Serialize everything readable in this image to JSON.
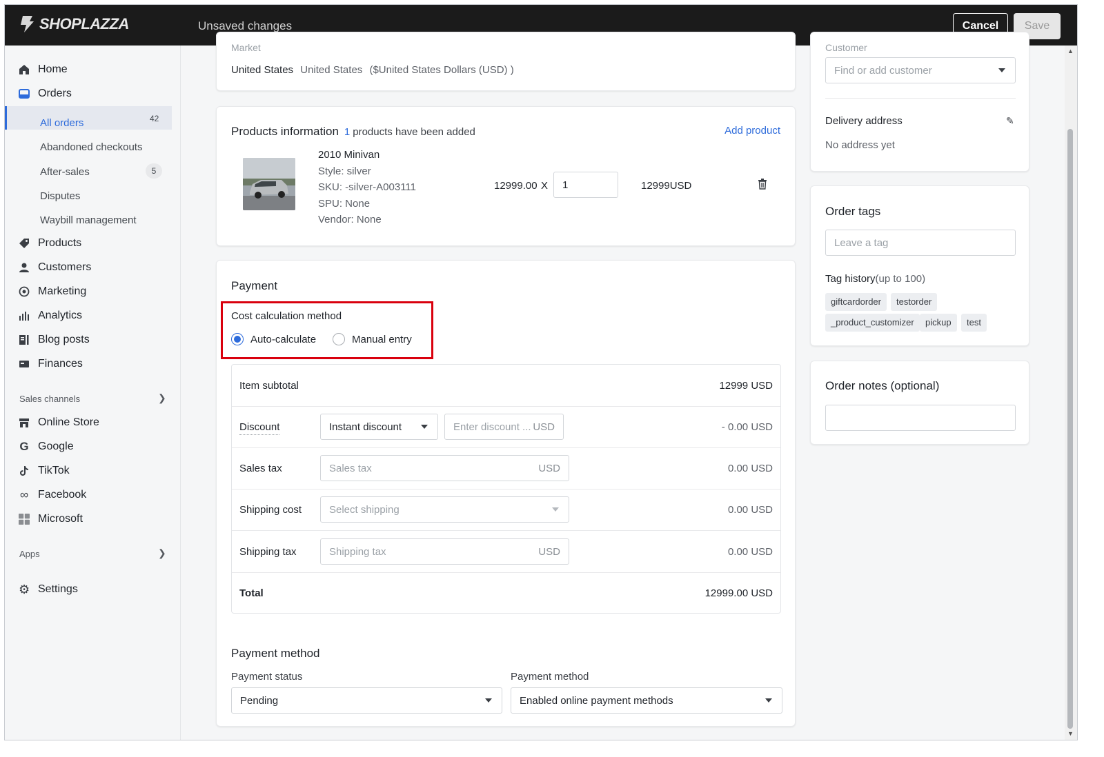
{
  "topbar": {
    "logo": "SHOPLAZZA",
    "status": "Unsaved changes",
    "cancel_label": "Cancel",
    "save_label": "Save"
  },
  "sidebar": {
    "home": "Home",
    "orders": "Orders",
    "all_orders": "All orders",
    "all_orders_count": "42",
    "abandoned": "Abandoned checkouts",
    "after_sales": "After-sales",
    "after_sales_count": "5",
    "disputes": "Disputes",
    "waybill": "Waybill management",
    "products": "Products",
    "customers": "Customers",
    "marketing": "Marketing",
    "analytics": "Analytics",
    "blog_posts": "Blog posts",
    "finances": "Finances",
    "sales_channels": "Sales channels",
    "online_store": "Online Store",
    "google": "Google",
    "tiktok": "TikTok",
    "facebook": "Facebook",
    "microsoft": "Microsoft",
    "apps": "Apps",
    "settings": "Settings"
  },
  "market": {
    "label": "Market",
    "country": "United States",
    "detail": "United States",
    "currency": "($United States Dollars (USD) )"
  },
  "products": {
    "title": "Products information",
    "count": "1",
    "count_suffix": "products have been added",
    "add_label": "Add product",
    "item": {
      "name": "2010 Minivan",
      "style": "Style: silver",
      "sku": "SKU: -silver-A003111",
      "spu": "SPU: None",
      "vendor": "Vendor: None",
      "price": "12999.00",
      "times": "X",
      "qty": "1",
      "total": "12999USD"
    }
  },
  "payment": {
    "title": "Payment",
    "method_label": "Cost calculation method",
    "auto_label": "Auto-calculate",
    "manual_label": "Manual entry",
    "highlight_color": "#d9000d",
    "subtotal_label": "Item subtotal",
    "subtotal_value": "12999 USD",
    "discount_label": "Discount",
    "discount_type": "Instant discount",
    "discount_placeholder": "Enter discount ...",
    "discount_unit": "USD",
    "discount_value": "- 0.00 USD",
    "sales_tax_label": "Sales tax",
    "sales_tax_placeholder": "Sales tax",
    "sales_tax_unit": "USD",
    "sales_tax_value": "0.00 USD",
    "shipping_label": "Shipping cost",
    "shipping_placeholder": "Select shipping",
    "shipping_value": "0.00 USD",
    "shipping_tax_label": "Shipping tax",
    "shipping_tax_placeholder": "Shipping tax",
    "shipping_tax_unit": "USD",
    "shipping_tax_value": "0.00 USD",
    "total_label": "Total",
    "total_value": "12999.00 USD"
  },
  "payment_method": {
    "title": "Payment method",
    "status_label": "Payment status",
    "status_value": "Pending",
    "method_label": "Payment method",
    "method_value": "Enabled online payment methods"
  },
  "customer": {
    "label": "Customer",
    "placeholder": "Find or add customer",
    "delivery_title": "Delivery address",
    "delivery_value": "No address yet"
  },
  "tags": {
    "title": "Order tags",
    "placeholder": "Leave a tag",
    "history_label": "Tag history",
    "history_limit": "(up to 100)",
    "items": [
      "giftcardorder",
      "testorder",
      "_product_customizer",
      "pickup",
      "test"
    ]
  },
  "notes": {
    "title": "Order notes (optional)"
  }
}
